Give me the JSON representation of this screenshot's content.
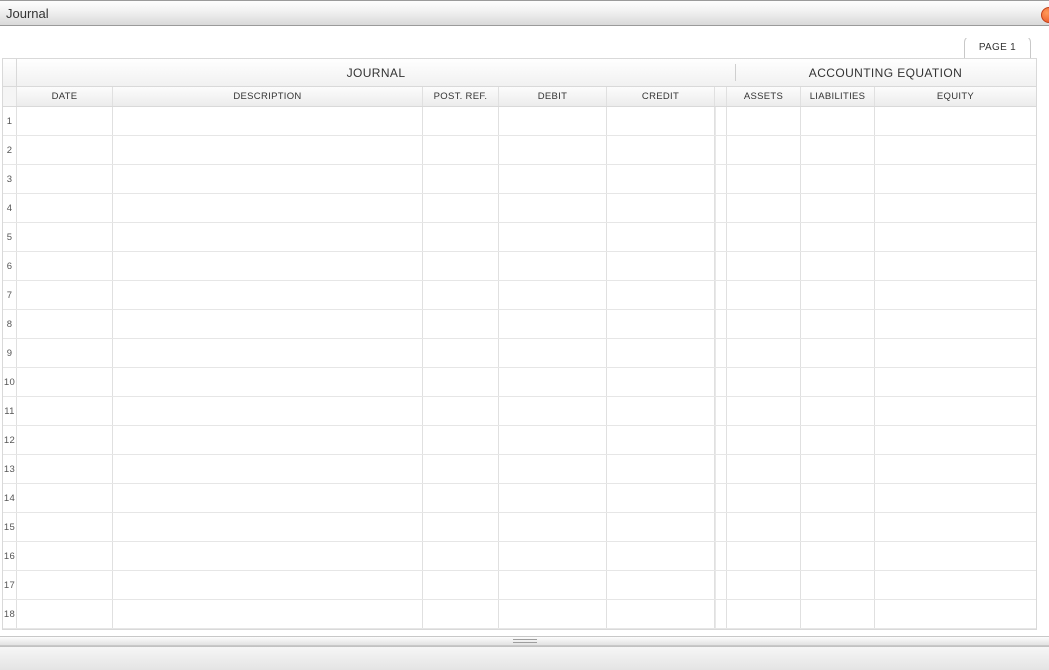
{
  "window": {
    "title": "Journal"
  },
  "page_tab": "PAGE 1",
  "group_headers": {
    "journal": "JOURNAL",
    "equation": "ACCOUNTING EQUATION"
  },
  "columns": {
    "date": "DATE",
    "description": "DESCRIPTION",
    "postref": "POST. REF.",
    "debit": "DEBIT",
    "credit": "CREDIT",
    "assets": "ASSETS",
    "liabilities": "LIABILITIES",
    "equity": "EQUITY"
  },
  "rows": [
    {
      "n": "1",
      "date": "",
      "description": "",
      "postref": "",
      "debit": "",
      "credit": "",
      "assets": "",
      "liabilities": "",
      "equity": ""
    },
    {
      "n": "2",
      "date": "",
      "description": "",
      "postref": "",
      "debit": "",
      "credit": "",
      "assets": "",
      "liabilities": "",
      "equity": ""
    },
    {
      "n": "3",
      "date": "",
      "description": "",
      "postref": "",
      "debit": "",
      "credit": "",
      "assets": "",
      "liabilities": "",
      "equity": ""
    },
    {
      "n": "4",
      "date": "",
      "description": "",
      "postref": "",
      "debit": "",
      "credit": "",
      "assets": "",
      "liabilities": "",
      "equity": ""
    },
    {
      "n": "5",
      "date": "",
      "description": "",
      "postref": "",
      "debit": "",
      "credit": "",
      "assets": "",
      "liabilities": "",
      "equity": ""
    },
    {
      "n": "6",
      "date": "",
      "description": "",
      "postref": "",
      "debit": "",
      "credit": "",
      "assets": "",
      "liabilities": "",
      "equity": ""
    },
    {
      "n": "7",
      "date": "",
      "description": "",
      "postref": "",
      "debit": "",
      "credit": "",
      "assets": "",
      "liabilities": "",
      "equity": ""
    },
    {
      "n": "8",
      "date": "",
      "description": "",
      "postref": "",
      "debit": "",
      "credit": "",
      "assets": "",
      "liabilities": "",
      "equity": ""
    },
    {
      "n": "9",
      "date": "",
      "description": "",
      "postref": "",
      "debit": "",
      "credit": "",
      "assets": "",
      "liabilities": "",
      "equity": ""
    },
    {
      "n": "10",
      "date": "",
      "description": "",
      "postref": "",
      "debit": "",
      "credit": "",
      "assets": "",
      "liabilities": "",
      "equity": ""
    },
    {
      "n": "11",
      "date": "",
      "description": "",
      "postref": "",
      "debit": "",
      "credit": "",
      "assets": "",
      "liabilities": "",
      "equity": ""
    },
    {
      "n": "12",
      "date": "",
      "description": "",
      "postref": "",
      "debit": "",
      "credit": "",
      "assets": "",
      "liabilities": "",
      "equity": ""
    },
    {
      "n": "13",
      "date": "",
      "description": "",
      "postref": "",
      "debit": "",
      "credit": "",
      "assets": "",
      "liabilities": "",
      "equity": ""
    },
    {
      "n": "14",
      "date": "",
      "description": "",
      "postref": "",
      "debit": "",
      "credit": "",
      "assets": "",
      "liabilities": "",
      "equity": ""
    },
    {
      "n": "15",
      "date": "",
      "description": "",
      "postref": "",
      "debit": "",
      "credit": "",
      "assets": "",
      "liabilities": "",
      "equity": ""
    },
    {
      "n": "16",
      "date": "",
      "description": "",
      "postref": "",
      "debit": "",
      "credit": "",
      "assets": "",
      "liabilities": "",
      "equity": ""
    },
    {
      "n": "17",
      "date": "",
      "description": "",
      "postref": "",
      "debit": "",
      "credit": "",
      "assets": "",
      "liabilities": "",
      "equity": ""
    },
    {
      "n": "18",
      "date": "",
      "description": "",
      "postref": "",
      "debit": "",
      "credit": "",
      "assets": "",
      "liabilities": "",
      "equity": ""
    }
  ]
}
